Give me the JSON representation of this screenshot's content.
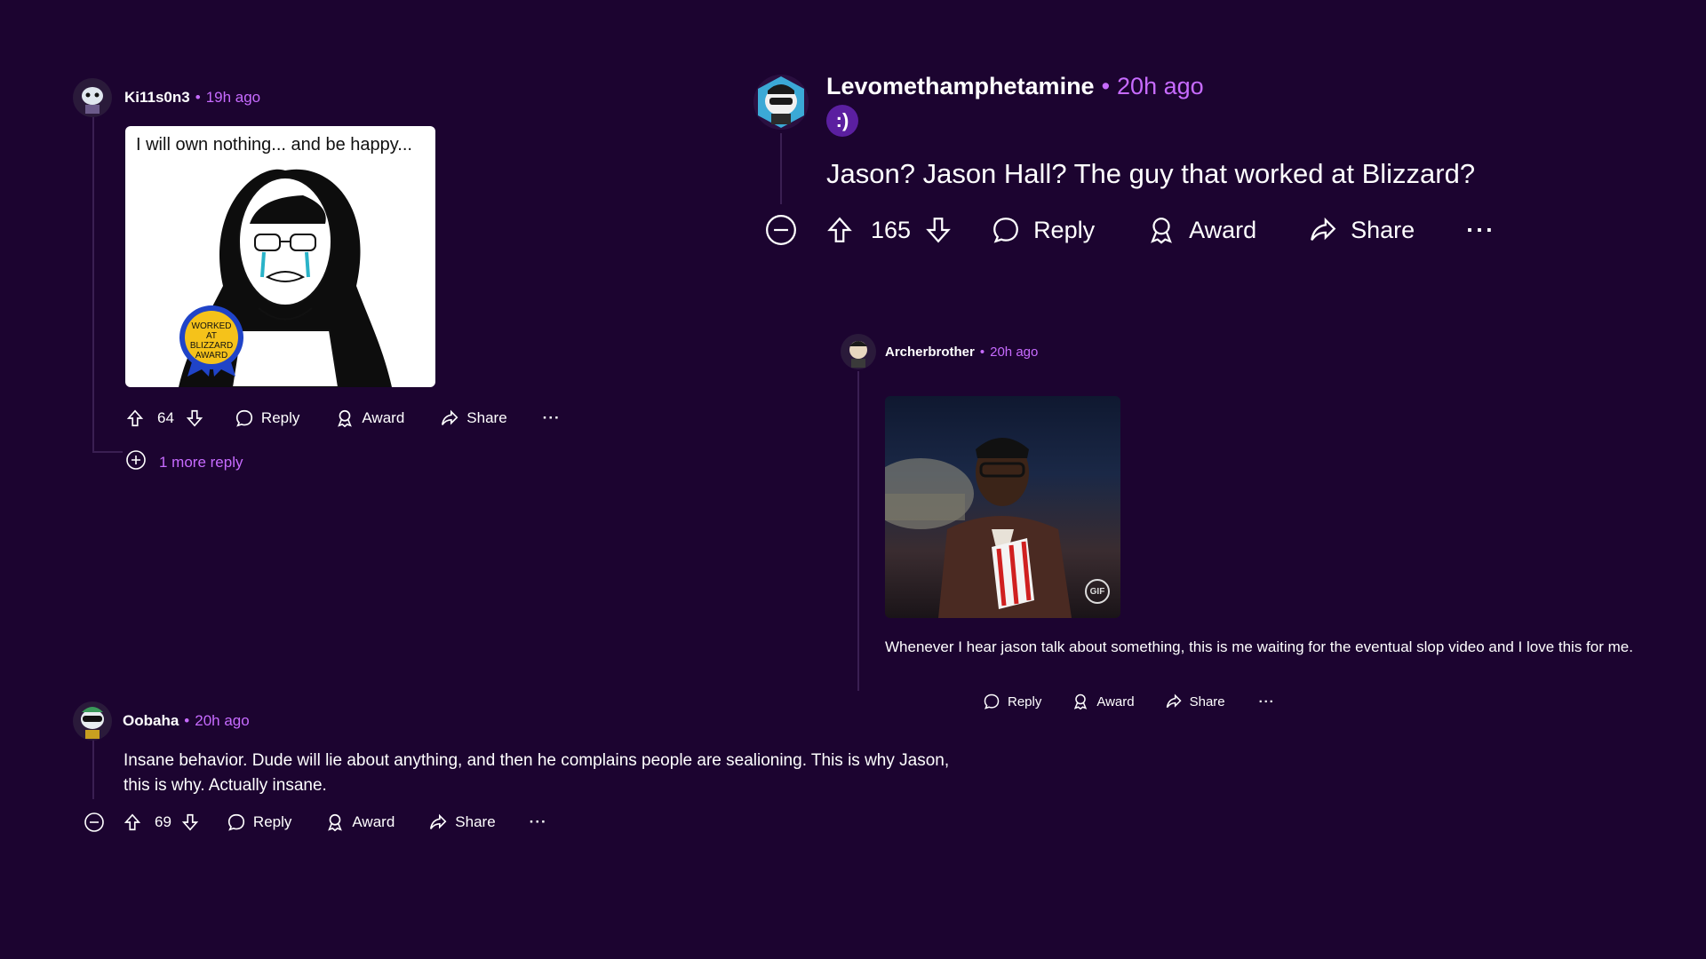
{
  "comments": {
    "ki": {
      "username": "Ki11s0n3",
      "time": "19h ago",
      "image_text": "I will own nothing... and be happy...",
      "badge_text": "WORKED AT BLIZZARD AWARD",
      "votes": "64",
      "reply_label": "Reply",
      "award_label": "Award",
      "share_label": "Share",
      "more_label": "···",
      "more_replies": "1 more reply"
    },
    "levo": {
      "username": "Levomethamphetamine",
      "time": "20h ago",
      "flair": ":)",
      "text": "Jason? Jason Hall? The guy that worked at Blizzard?",
      "votes": "165",
      "reply_label": "Reply",
      "award_label": "Award",
      "share_label": "Share",
      "more_label": "···"
    },
    "archer": {
      "username": "Archerbrother",
      "time": "20h ago",
      "gif_badge": "GIF",
      "text": "Whenever I hear jason talk about something, this is me waiting for the eventual slop video and I love this for me.",
      "reply_label": "Reply",
      "award_label": "Award",
      "share_label": "Share",
      "more_label": "···"
    },
    "oobaha": {
      "username": "Oobaha",
      "time": "20h ago",
      "text": "Insane behavior. Dude will lie about anything, and then he complains people are sealioning. This is why Jason, this is why. Actually insane.",
      "votes": "69",
      "reply_label": "Reply",
      "award_label": "Award",
      "share_label": "Share",
      "more_label": "···"
    }
  },
  "separator": "•",
  "colors": {
    "background": "#1c0430",
    "accent": "#c76bff",
    "thread_line": "#3a1f52",
    "flair": "#5b1fa0"
  },
  "icons": [
    "upvote-icon",
    "downvote-icon",
    "reply-icon",
    "award-icon",
    "share-icon",
    "more-icon",
    "collapse-icon",
    "expand-icon"
  ]
}
